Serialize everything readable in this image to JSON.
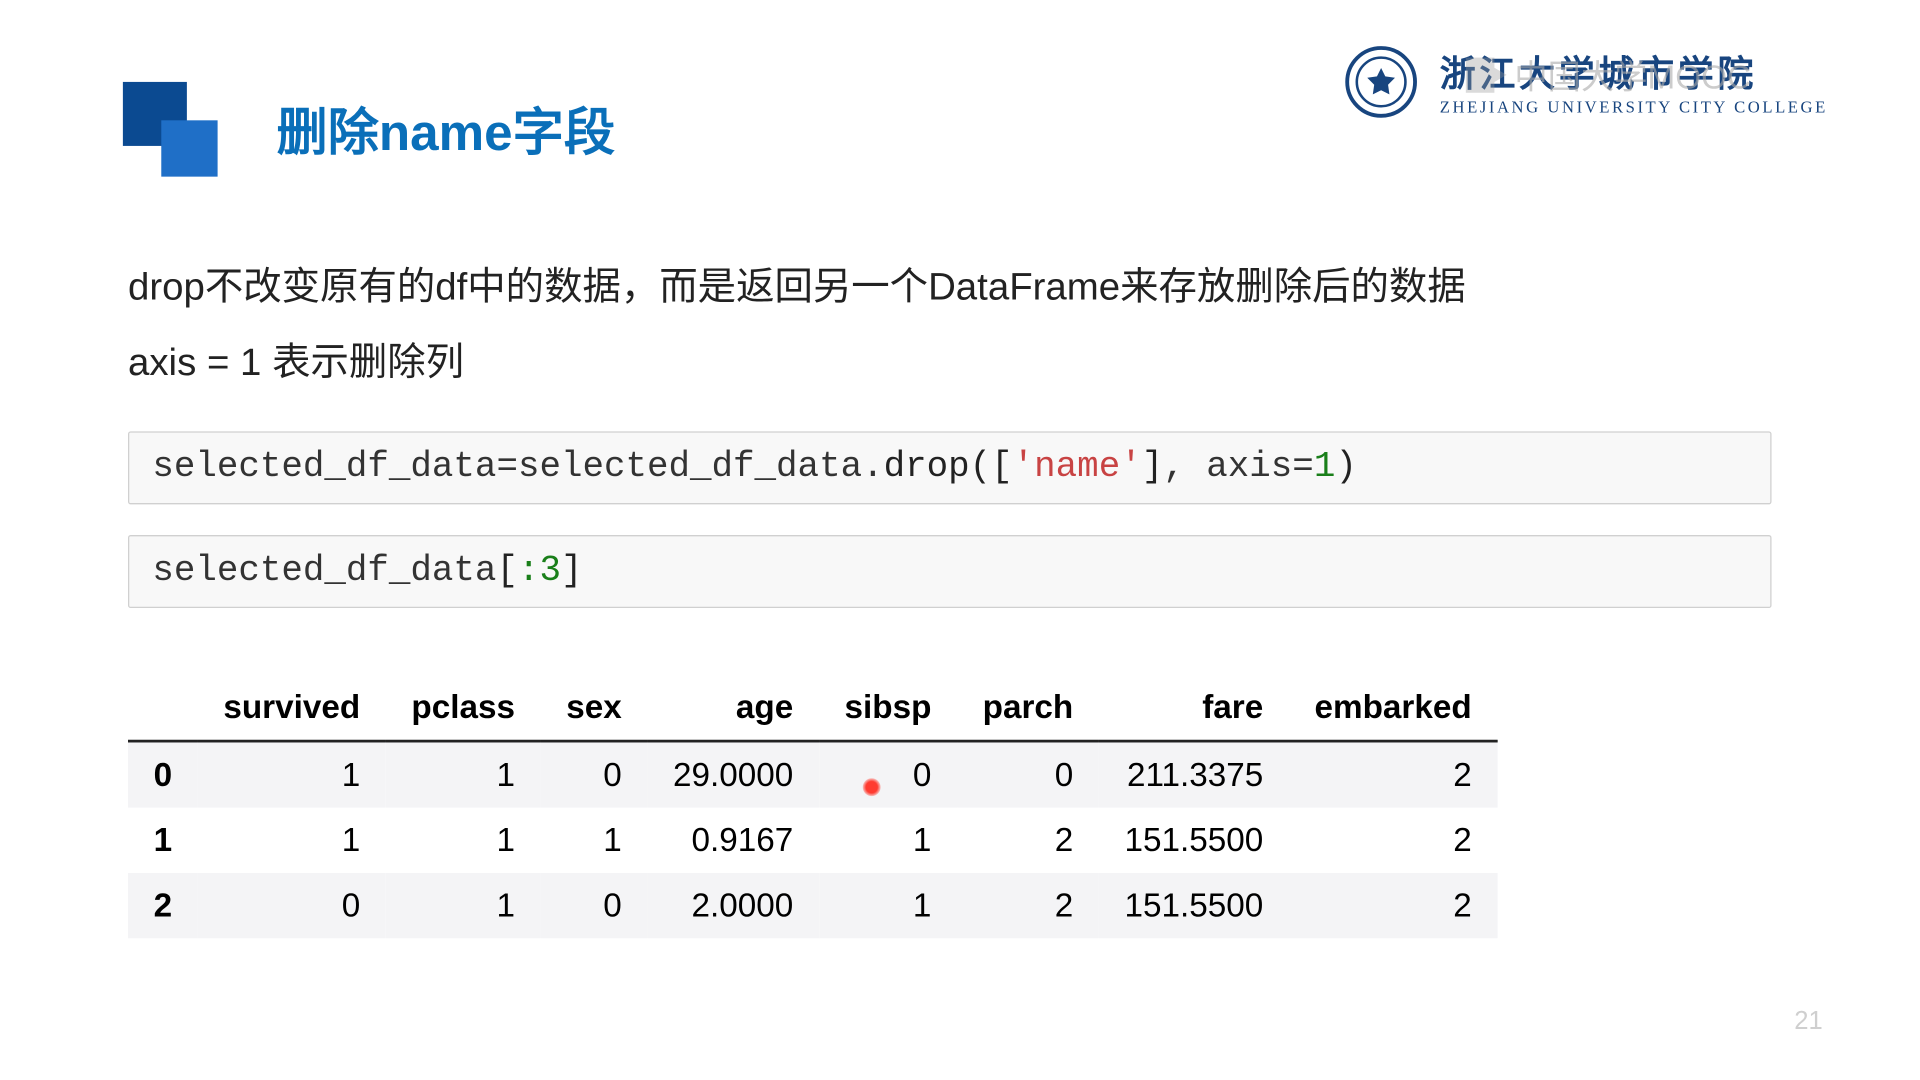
{
  "org": {
    "cn": "浙江大学城市学院",
    "en": "ZHEJIANG UNIVERSITY CITY COLLEGE"
  },
  "watermark": "中国大学MOOC",
  "title": "删除name字段",
  "body": {
    "line1": "drop不改变原有的df中的数据，而是返回另一个DataFrame来存放删除后的数据",
    "line2": "axis = 1 表示删除列"
  },
  "code": {
    "cell1": {
      "lhs": "selected_df_data",
      "eq": "=",
      "rhs_obj": "selected_df_data",
      "dot": ".",
      "method": "drop",
      "open": "([",
      "str": "'name'",
      "close_bracket": "]",
      "comma": ", ",
      "kw": "axis",
      "assign": "=",
      "num": "1",
      "close": ")"
    },
    "cell2": {
      "obj": "selected_df_data",
      "open": "[",
      "slice": ":3",
      "close": "]"
    }
  },
  "chart_data": {
    "type": "table",
    "columns": [
      "survived",
      "pclass",
      "sex",
      "age",
      "sibsp",
      "parch",
      "fare",
      "embarked"
    ],
    "index": [
      "0",
      "1",
      "2"
    ],
    "rows": [
      {
        "survived": "1",
        "pclass": "1",
        "sex": "0",
        "age": "29.0000",
        "sibsp": "0",
        "parch": "0",
        "fare": "211.3375",
        "embarked": "2"
      },
      {
        "survived": "1",
        "pclass": "1",
        "sex": "1",
        "age": "0.9167",
        "sibsp": "1",
        "parch": "2",
        "fare": "151.5500",
        "embarked": "2"
      },
      {
        "survived": "0",
        "pclass": "1",
        "sex": "0",
        "age": "2.0000",
        "sibsp": "1",
        "parch": "2",
        "fare": "151.5500",
        "embarked": "2"
      }
    ]
  },
  "page_number": "21"
}
